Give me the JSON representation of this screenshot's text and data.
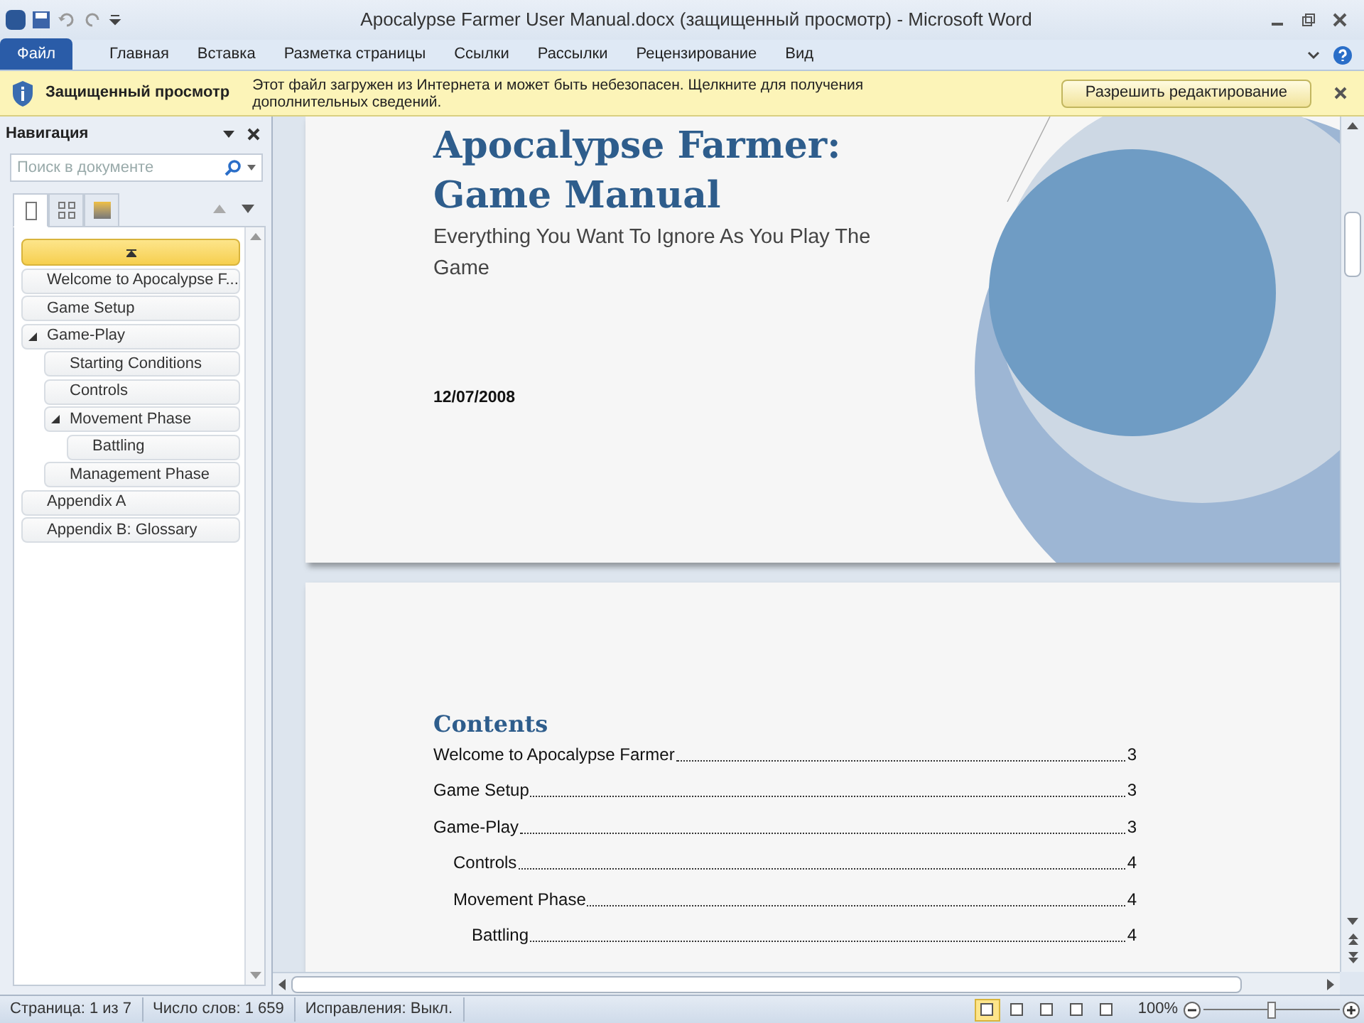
{
  "window": {
    "title": "Apocalypse Farmer User Manual.docx (защищенный просмотр)  -  Microsoft Word"
  },
  "ribbon_tabs": [
    {
      "label": "Файл",
      "selected": true
    },
    {
      "label": "Главная",
      "selected": false
    },
    {
      "label": "Вставка",
      "selected": false
    },
    {
      "label": "Разметка страницы",
      "selected": false
    },
    {
      "label": "Ссылки",
      "selected": false
    },
    {
      "label": "Рассылки",
      "selected": false
    },
    {
      "label": "Рецензирование",
      "selected": false
    },
    {
      "label": "Вид",
      "selected": false
    }
  ],
  "message_bar": {
    "title": "Защищенный просмотр",
    "text": "Этот файл загружен из Интернета и может быть небезопасен. Щелкните для получения дополнительных сведений.",
    "button": "Разрешить редактирование"
  },
  "navigation": {
    "title": "Навигация",
    "search": {
      "placeholder": "Поиск в документе"
    },
    "tabs": [
      {
        "selected": true
      },
      {
        "selected": false
      },
      {
        "selected": false
      }
    ],
    "headings": [
      {
        "label": "Welcome to Apocalypse F..."
      },
      {
        "label": "Game Setup"
      },
      {
        "label": "Game-Play",
        "expanded": true,
        "children": [
          {
            "label": "Starting Conditions"
          },
          {
            "label": "Controls"
          },
          {
            "label": "Movement Phase",
            "expanded": true,
            "children": [
              {
                "label": "Battling"
              }
            ]
          },
          {
            "label": "Management Phase"
          }
        ]
      },
      {
        "label": "Appendix A"
      },
      {
        "label": "Appendix B: Glossary"
      }
    ]
  },
  "cover_page": {
    "title_lines": [
      "Apocalypse Farmer:",
      "Game Manual"
    ],
    "subtitle": "Everything You Want To Ignore As You Play The Game",
    "date": "12/07/2008"
  },
  "contents_page": {
    "heading": "Contents",
    "entries": [
      {
        "label": "Welcome to Apocalypse Farmer",
        "page": "3"
      },
      {
        "label": "Game Setup",
        "page": "3"
      },
      {
        "label": "Game-Play",
        "page": "3",
        "children": [
          {
            "label": "Controls",
            "page": "4"
          },
          {
            "label": "Movement Phase",
            "page": "4",
            "children": [
              {
                "label": "Battling",
                "page": "4"
              }
            ]
          }
        ]
      }
    ]
  },
  "status_bar": {
    "items": [
      "Страница: 1 из 7",
      "Число слов: 1 659",
      "Исправления: Выкл."
    ],
    "view_buttons": [
      {
        "selected": true
      },
      {
        "selected": false
      },
      {
        "selected": false
      },
      {
        "selected": false
      },
      {
        "selected": false
      }
    ],
    "zoom": "100%",
    "zoom_slider": {
      "level": 0.5
    }
  }
}
